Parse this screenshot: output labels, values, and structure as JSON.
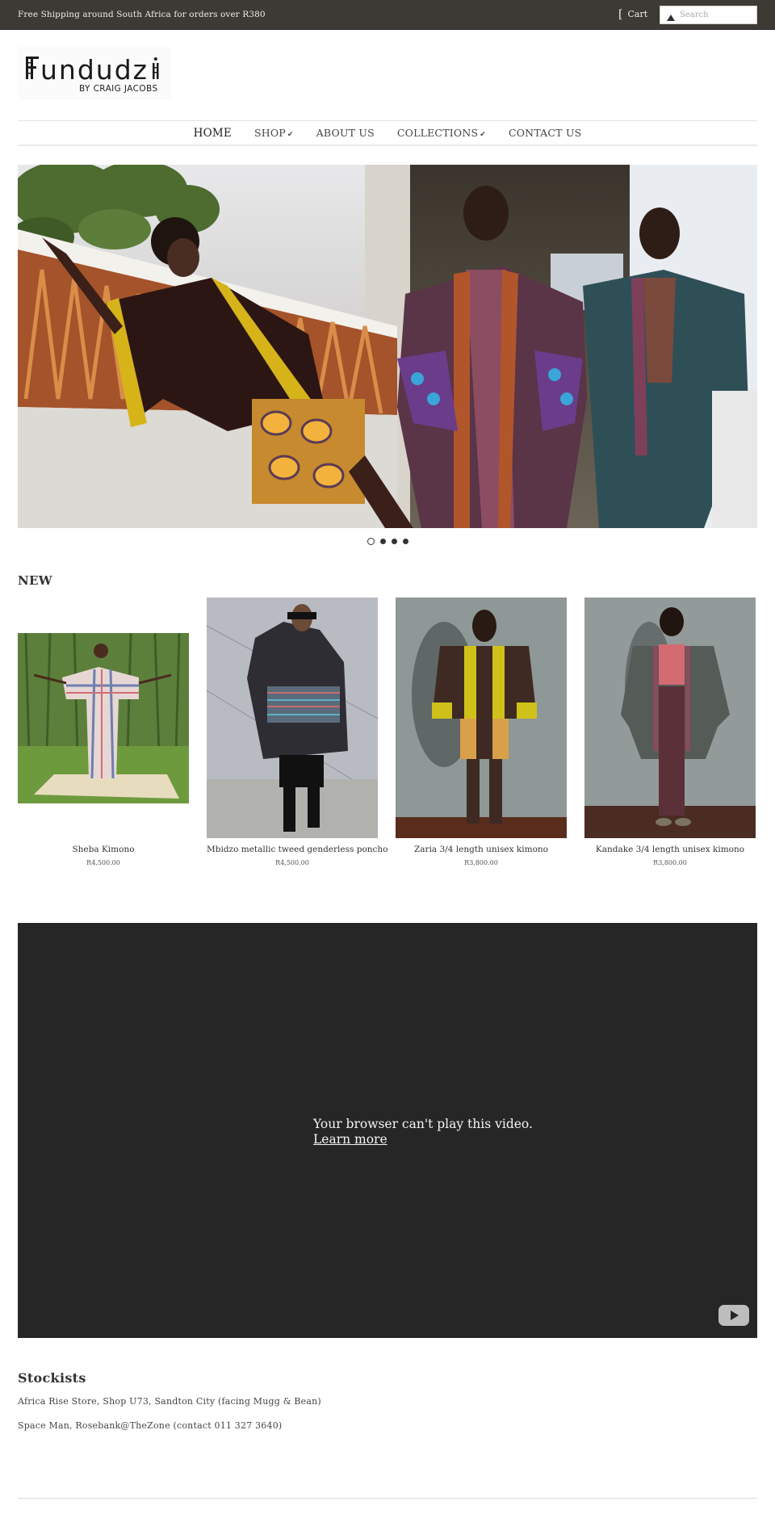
{
  "topbar": {
    "promo": "Free Shipping around South Africa for orders over R380",
    "cart_icon": "cart-bracket-icon",
    "cart_label": "Cart",
    "search_icon": "search-triangle-icon",
    "search_placeholder": "Search",
    "search_value": ""
  },
  "logo": {
    "word": "Fundudzi",
    "tagline": "BY CRAIG JACOBS"
  },
  "nav": {
    "items": [
      {
        "label": "HOME",
        "active": true,
        "dropdown": false
      },
      {
        "label": "SHOP",
        "active": false,
        "dropdown": true
      },
      {
        "label": "ABOUT US",
        "active": false,
        "dropdown": false
      },
      {
        "label": "COLLECTIONS",
        "active": false,
        "dropdown": true
      },
      {
        "label": "CONTACT US",
        "active": false,
        "dropdown": false
      }
    ],
    "dropdown_glyph": "✔"
  },
  "hero": {
    "alt": "Three models wearing Fundudzi kimonos on a balcony",
    "slides_total": 4,
    "active_slide": 1
  },
  "new_section": {
    "title": "NEW",
    "products": [
      {
        "name": "Sheba Kimono",
        "price": "R4,500.00"
      },
      {
        "name": "Mbidzo metallic tweed genderless poncho",
        "price": "R4,500.00"
      },
      {
        "name": "Zaria 3/4 length unisex kimono",
        "price": "R3,800.00"
      },
      {
        "name": "Kandake 3/4 length unisex kimono",
        "price": "R3,800.00"
      }
    ]
  },
  "video": {
    "message": "Your browser can't play this video.",
    "link": "Learn more",
    "play_icon": "youtube-play-icon"
  },
  "stockists": {
    "title": "Stockists",
    "entries": [
      "Africa Rise Store, Shop U73, Sandton City (facing Mugg & Bean)",
      "Space Man, Rosebank@TheZone (contact 011 327 3640)"
    ]
  },
  "colors": {
    "topbar_bg": "#3d3935",
    "video_bg": "#262626",
    "text": "#333333"
  }
}
